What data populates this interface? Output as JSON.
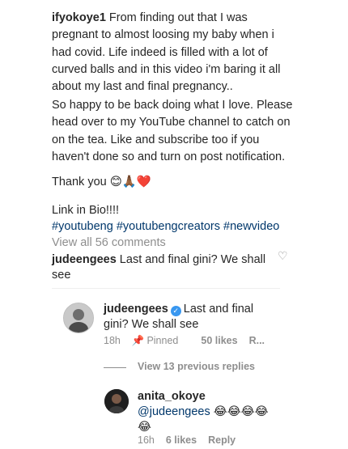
{
  "post": {
    "username": "ifyokoye1",
    "caption_p1": " From finding out that I was pregnant to almost loosing my baby when i had covid. Life indeed is filled with a lot of curved balls and in this video i'm baring it all about my last and final pregnancy..",
    "caption_p2": "So happy to be back doing what I love. Please head over to my YouTube channel to catch on on the tea. Like and subscribe too if you haven't done so and turn on post notification.",
    "thank_you": "Thank you ",
    "thank_you_emoji": "😊🙏🏾❤️",
    "link_in_bio": "Link in Bio!!!!",
    "hashtags": "#youtubeng #youtubengcreators #newvideo",
    "view_all": "View all 56 comments"
  },
  "comment": {
    "username": "judeengees",
    "text_line1": " Last and final gini? We shall",
    "text_line2": "see",
    "like_icon": "heart-outline-icon"
  },
  "reply1": {
    "username": "judeengees",
    "verified_icon": "verified-badge-icon",
    "text": "Last and final gini? We shall see",
    "time": "18h",
    "pinned_icon": "pin-icon",
    "pinned": "Pinned",
    "likes": "50 likes",
    "reply": "R..."
  },
  "view_previous": "View 13 previous replies",
  "reply2": {
    "username": "anita_okoye",
    "mention": "@judeengees",
    "emoji": "😂😂😂😂😂",
    "time": "16h",
    "likes": "6 likes",
    "reply": "Reply"
  }
}
